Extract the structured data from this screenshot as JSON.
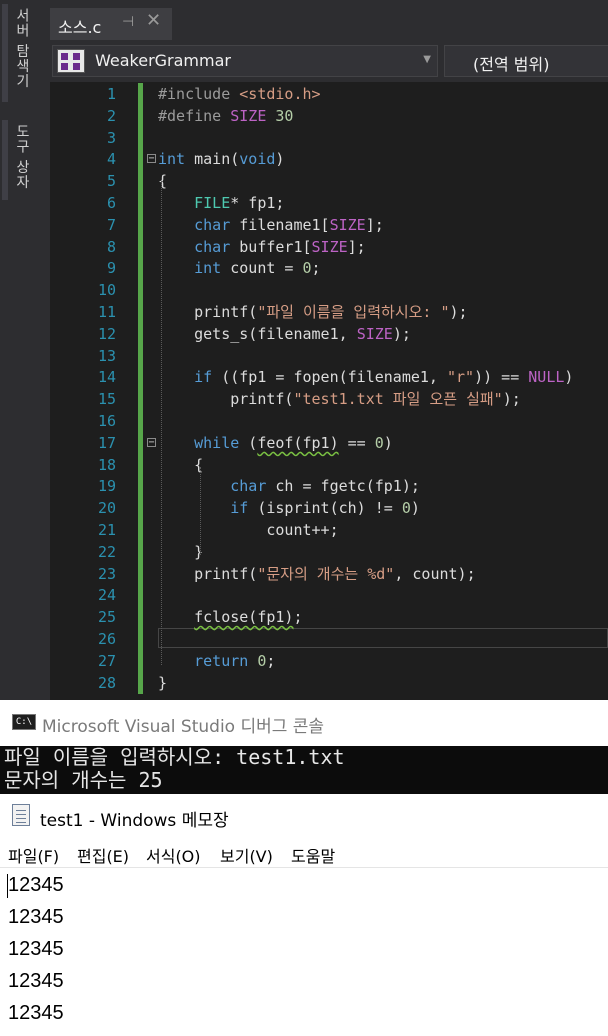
{
  "ide": {
    "side_tabs": [
      "서버 탐색기",
      "도구 상자"
    ],
    "tab": {
      "label": "소스.c",
      "pin": "⊣",
      "close": "✕"
    },
    "project_dropdown": {
      "label": "WeakerGrammar"
    },
    "global_scope": {
      "label": "(전역 범위)"
    },
    "lines": [
      {
        "n": "1",
        "html": "<span class='pp'>#include</span> <span class='str'>&lt;stdio.h&gt;</span>"
      },
      {
        "n": "2",
        "html": "<span class='pp'>#define</span> <span class='mac'>SIZE</span> <span class='num'>30</span>"
      },
      {
        "n": "3",
        "html": ""
      },
      {
        "n": "4",
        "html": "<span class='kw'>int</span> main(<span class='kw'>void</span>)"
      },
      {
        "n": "5",
        "html": "{"
      },
      {
        "n": "6",
        "html": "    <span class='typ'>FILE</span>* fp1;"
      },
      {
        "n": "7",
        "html": "    <span class='kw'>char</span> filename1[<span class='mac'>SIZE</span>];"
      },
      {
        "n": "8",
        "html": "    <span class='kw'>char</span> buffer1[<span class='mac'>SIZE</span>];"
      },
      {
        "n": "9",
        "html": "    <span class='kw'>int</span> count = <span class='num'>0</span>;"
      },
      {
        "n": "10",
        "html": ""
      },
      {
        "n": "11",
        "html": "    printf(<span class='str'>\"파일 이름을 입력하시오: \"</span>);"
      },
      {
        "n": "12",
        "html": "    gets_s(filename1, <span class='mac'>SIZE</span>);"
      },
      {
        "n": "13",
        "html": ""
      },
      {
        "n": "14",
        "html": "    <span class='kw'>if</span> ((fp1 = fopen(filename1, <span class='str'>\"r\"</span>)) == <span class='mac'>NULL</span>)"
      },
      {
        "n": "15",
        "html": "        printf(<span class='str'>\"test1.txt 파일 오픈 실패\"</span>);"
      },
      {
        "n": "16",
        "html": ""
      },
      {
        "n": "17",
        "html": "    <span class='kw'>while</span> (<span class='wavy'>feof(fp1)</span> == <span class='num'>0</span>)"
      },
      {
        "n": "18",
        "html": "    {"
      },
      {
        "n": "19",
        "html": "        <span class='kw'>char</span> ch = fgetc(fp1);"
      },
      {
        "n": "20",
        "html": "        <span class='kw'>if</span> (isprint(ch) != <span class='num'>0</span>)"
      },
      {
        "n": "21",
        "html": "            count++;"
      },
      {
        "n": "22",
        "html": "    }"
      },
      {
        "n": "23",
        "html": "    printf(<span class='str'>\"문자의 개수는 %d\"</span>, count);"
      },
      {
        "n": "24",
        "html": ""
      },
      {
        "n": "25",
        "html": "    <span class='wavy'>fclose(fp1)</span>;"
      },
      {
        "n": "26",
        "html": ""
      },
      {
        "n": "27",
        "html": "    <span class='kw'>return</span> <span class='num'>0</span>;"
      },
      {
        "n": "28",
        "html": "}"
      }
    ]
  },
  "console": {
    "icon_text": "C:\\",
    "title": "Microsoft Visual Studio 디버그 콘솔",
    "output": [
      "파일 이름을 입력하시오: test1.txt",
      "문자의 개수는 25"
    ]
  },
  "notepad": {
    "title": "test1 - Windows 메모장",
    "menu": [
      "파일(F)",
      "편집(E)",
      "서식(O)",
      "보기(V)",
      "도움말"
    ],
    "lines": [
      "12345",
      "12345",
      "12345",
      "12345",
      "12345"
    ]
  }
}
